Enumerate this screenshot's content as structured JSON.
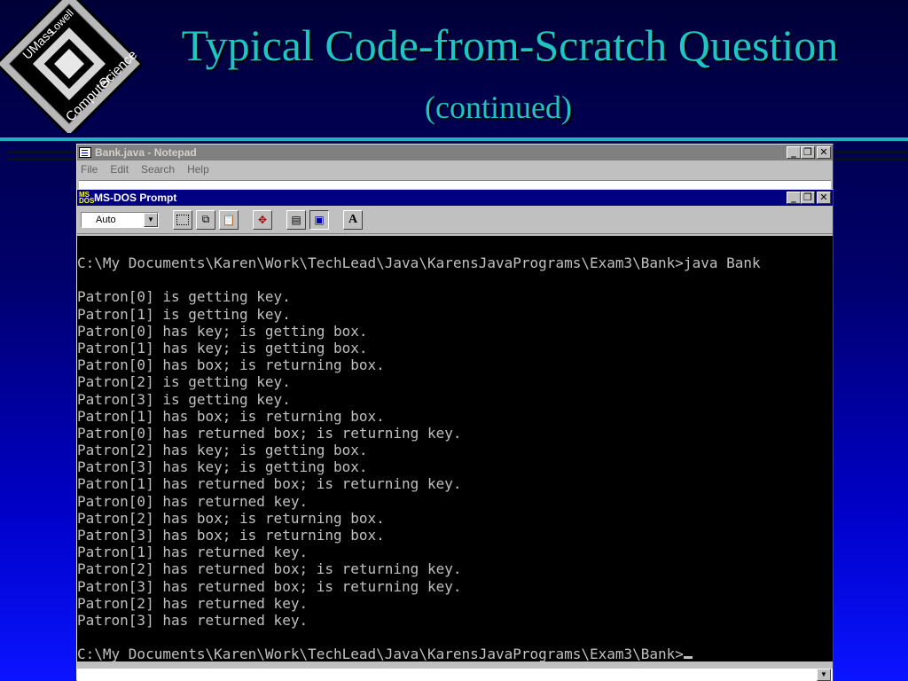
{
  "logo": {
    "top_text": "UMass",
    "top_right_text": "Lowell",
    "bottom_left_text": "Computer",
    "bottom_right_text": "Science"
  },
  "slide": {
    "title": "Typical Code-from-Scratch Question",
    "subtitle": "(continued)"
  },
  "notepad": {
    "title": "Bank.java - Notepad",
    "menu": [
      "File",
      "Edit",
      "Search",
      "Help"
    ]
  },
  "dos": {
    "title": "MS-DOS Prompt",
    "font_select_value": "Auto",
    "icon_label": "MS DOS",
    "lines": [
      "C:\\My Documents\\Karen\\Work\\TechLead\\Java\\KarensJavaPrograms\\Exam3\\Bank>java Bank",
      "",
      "Patron[0] is getting key.",
      "Patron[1] is getting key.",
      "Patron[0] has key; is getting box.",
      "Patron[1] has key; is getting box.",
      "Patron[0] has box; is returning box.",
      "Patron[2] is getting key.",
      "Patron[3] is getting key.",
      "Patron[1] has box; is returning box.",
      "Patron[0] has returned box; is returning key.",
      "Patron[2] has key; is getting box.",
      "Patron[3] has key; is getting box.",
      "Patron[1] has returned box; is returning key.",
      "Patron[0] has returned key.",
      "Patron[2] has box; is returning box.",
      "Patron[3] has box; is returning box.",
      "Patron[1] has returned key.",
      "Patron[2] has returned box; is returning key.",
      "Patron[3] has returned box; is returning key.",
      "Patron[2] has returned key.",
      "Patron[3] has returned key.",
      ""
    ],
    "prompt": "C:\\My Documents\\Karen\\Work\\TechLead\\Java\\KarensJavaPrograms\\Exam3\\Bank>"
  },
  "colors": {
    "title_teal": "#1fc4c4",
    "dos_titlebar": "#000080",
    "terminal_text": "#c0c0c0"
  }
}
